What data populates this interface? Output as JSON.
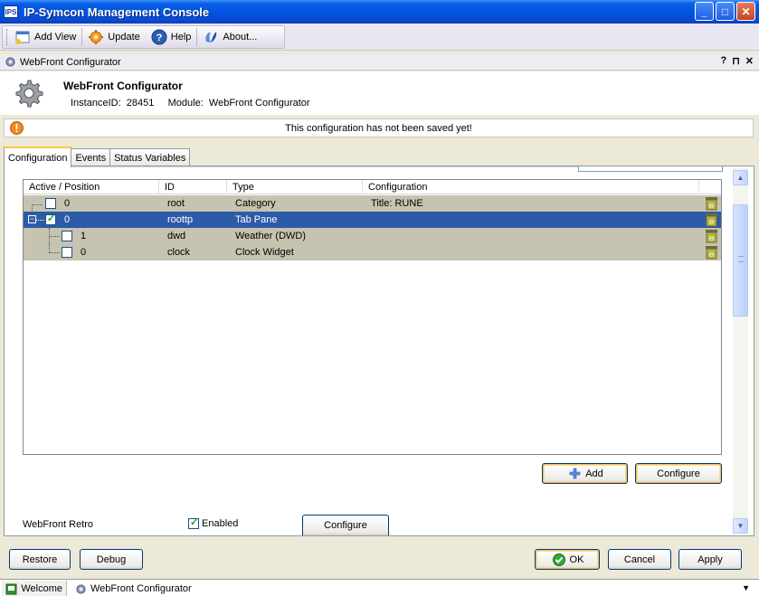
{
  "window": {
    "title": "IP-Symcon Management Console",
    "app_icon_text": "IPS",
    "minimize": "_",
    "maximize": "□",
    "close": "✕"
  },
  "toolbar": {
    "add_view": "Add View",
    "update": "Update",
    "help": "Help",
    "about": "About..."
  },
  "panel": {
    "title": "WebFront Configurator",
    "help": "?",
    "pin": "⊓",
    "close": "✕"
  },
  "instance": {
    "name": "WebFront Configurator",
    "id_label": "InstanceID:",
    "id_value": "28451",
    "module_label": "Module:",
    "module_value": "WebFront Configurator"
  },
  "warning": {
    "text": "This configuration has not been saved yet!"
  },
  "tabs": [
    "Configuration",
    "Events",
    "Status Variables"
  ],
  "table": {
    "columns": [
      "Active / Position",
      "ID",
      "Type",
      "Configuration"
    ],
    "rows": [
      {
        "position": "0",
        "id": "root",
        "type": "Category",
        "config": "Title: RUNE",
        "active": false
      },
      {
        "position": "0",
        "id": "roottp",
        "type": "Tab Pane",
        "config": "",
        "active": true
      },
      {
        "position": "1",
        "id": "dwd",
        "type": "Weather (DWD)",
        "config": "",
        "active": false
      },
      {
        "position": "0",
        "id": "clock",
        "type": "Clock Widget",
        "config": "",
        "active": false
      }
    ]
  },
  "table_buttons": {
    "add": "Add",
    "configure": "Configure"
  },
  "retro": {
    "label": "WebFront Retro",
    "enabled_label": "Enabled",
    "enabled": true,
    "configure": "Configure"
  },
  "footer": {
    "restore": "Restore",
    "debug": "Debug",
    "ok": "OK",
    "cancel": "Cancel",
    "apply": "Apply"
  },
  "doc_tabs": [
    "Welcome",
    "WebFront Configurator"
  ],
  "colors": {
    "selected_row": "#2E5BA8",
    "row": "#C6C3B0",
    "title_bar": "#0054E3",
    "warning": "#F08A24"
  }
}
